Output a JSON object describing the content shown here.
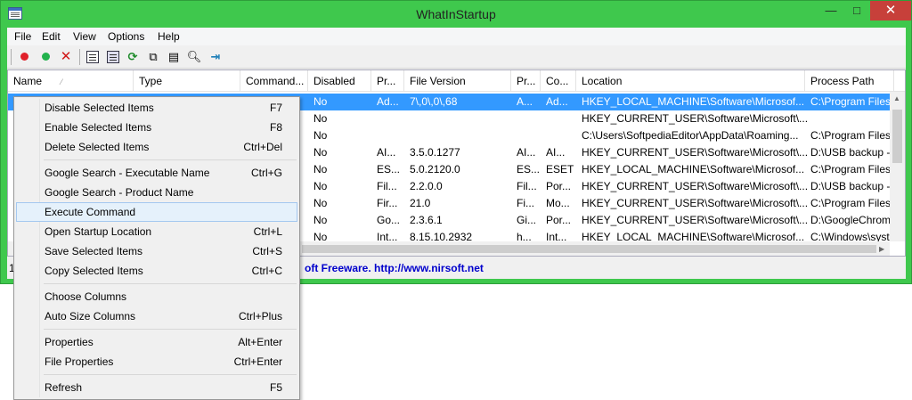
{
  "window": {
    "title": "WhatInStartup",
    "minimize": "—",
    "maximize": "□",
    "close": "✕"
  },
  "menu": [
    "File",
    "Edit",
    "View",
    "Options",
    "Help"
  ],
  "toolbar": {
    "icons": [
      "disable-icon",
      "enable-icon",
      "delete-icon",
      "properties-icon",
      "save-icon",
      "refresh-icon",
      "copy-icon",
      "columns-icon",
      "search-icon",
      "exit-icon"
    ],
    "colors": {
      "disable": "#e0202a",
      "enable": "#22b24c",
      "delete": "#d01818"
    }
  },
  "columns": [
    "Name",
    "Type",
    "Command...",
    "Disabled",
    "Pr...",
    "File Version",
    "Pr...",
    "Co...",
    "Location",
    "Process Path"
  ],
  "rows": [
    [
      "No",
      "Ad...",
      "7\\,0\\,0\\,68",
      "A...",
      "Ad...",
      "HKEY_LOCAL_MACHINE\\Software\\Microsof...",
      "C:\\Program Files"
    ],
    [
      "No",
      "",
      "",
      "",
      "",
      "HKEY_CURRENT_USER\\Software\\Microsoft\\...",
      ""
    ],
    [
      "No",
      "",
      "",
      "",
      "",
      "C:\\Users\\SoftpediaEditor\\AppData\\Roaming...",
      "C:\\Program Files"
    ],
    [
      "No",
      "AI...",
      "3.5.0.1277",
      "AI...",
      "AI...",
      "HKEY_CURRENT_USER\\Software\\Microsoft\\...",
      "D:\\USB backup -"
    ],
    [
      "No",
      "ES...",
      "5.0.2120.0",
      "ES...",
      "ESET",
      "HKEY_LOCAL_MACHINE\\Software\\Microsof...",
      "C:\\Program Files\\"
    ],
    [
      "No",
      "Fil...",
      "2.2.0.0",
      "Fil...",
      "Por...",
      "HKEY_CURRENT_USER\\Software\\Microsoft\\...",
      "D:\\USB backup -"
    ],
    [
      "No",
      "Fir...",
      "21.0",
      "Fi...",
      "Mo...",
      "HKEY_CURRENT_USER\\Software\\Microsoft\\...",
      "C:\\Program Files"
    ],
    [
      "No",
      "Go...",
      "2.3.6.1",
      "Gi...",
      "Por...",
      "HKEY_CURRENT_USER\\Software\\Microsoft\\...",
      "D:\\GoogleChrom"
    ],
    [
      "No",
      "Int...",
      "8.15.10.2932",
      "h...",
      "Int...",
      "HKEY_LOCAL_MACHINE\\Software\\Microsof...",
      "C:\\Windows\\syst"
    ]
  ],
  "status": {
    "count": "1",
    "credit": "oft Freeware.  http://www.nirsoft.net"
  },
  "context_menu": [
    {
      "label": "Disable Selected Items",
      "key": "F7"
    },
    {
      "label": "Enable Selected Items",
      "key": "F8"
    },
    {
      "label": "Delete Selected Items",
      "key": "Ctrl+Del"
    },
    {
      "label": "Google Search - Executable Name",
      "key": "Ctrl+G"
    },
    {
      "label": "Google Search - Product Name",
      "key": ""
    },
    {
      "label": "Execute Command",
      "key": ""
    },
    {
      "label": "Open Startup Location",
      "key": "Ctrl+L"
    },
    {
      "label": "Save Selected Items",
      "key": "Ctrl+S"
    },
    {
      "label": "Copy Selected Items",
      "key": "Ctrl+C"
    },
    {
      "label": "Choose Columns",
      "key": ""
    },
    {
      "label": "Auto Size Columns",
      "key": "Ctrl+Plus"
    },
    {
      "label": "Properties",
      "key": "Alt+Enter"
    },
    {
      "label": "File Properties",
      "key": "Ctrl+Enter"
    },
    {
      "label": "Refresh",
      "key": "F5"
    }
  ]
}
